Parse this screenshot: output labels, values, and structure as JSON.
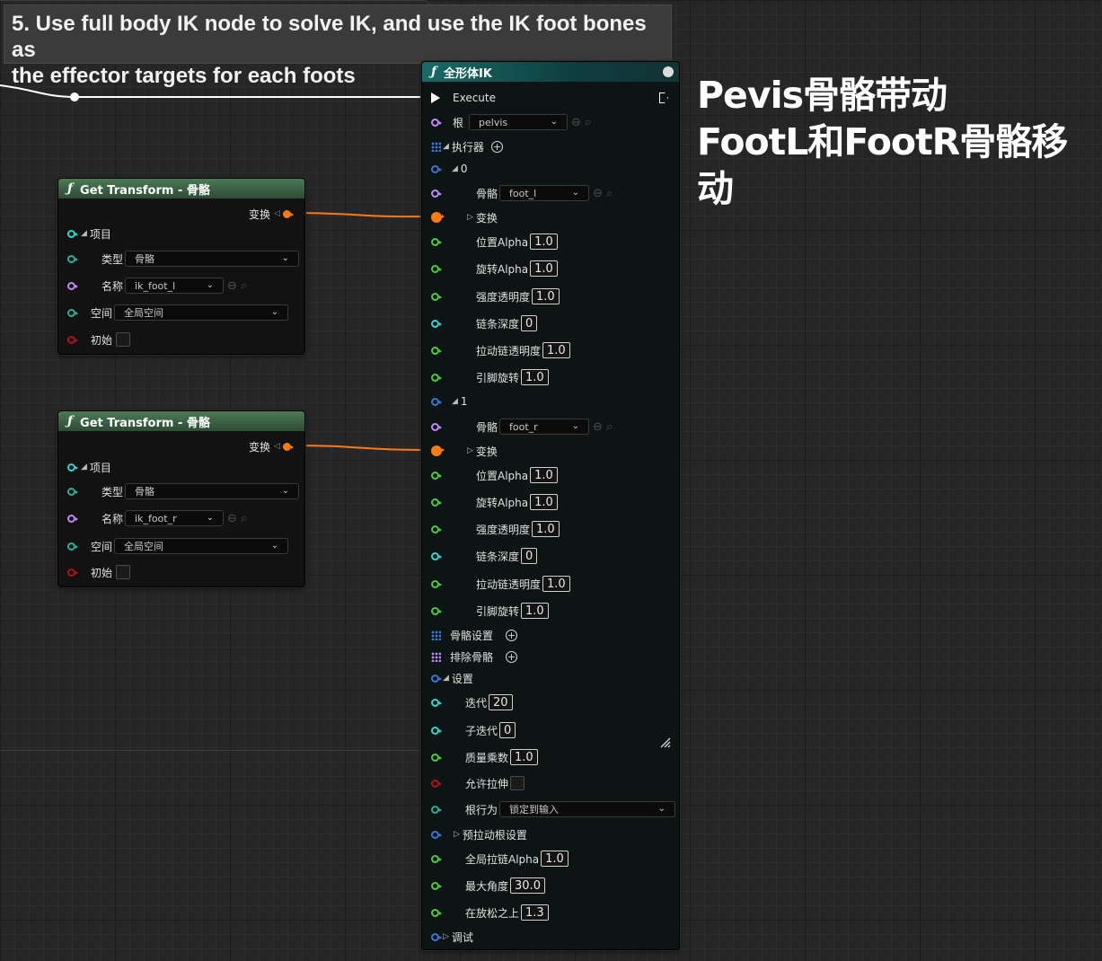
{
  "caption": {
    "line1": "5. Use full body IK node to solve IK, and use the IK foot bones as",
    "line2": "the effector targets for each foots"
  },
  "annotation": {
    "line1": "Pevis骨骼带动",
    "line2": "FootL和FootR骨骼移动"
  },
  "get_transform_1": {
    "title": "Get Transform - 骨骼",
    "output_label": "变换",
    "item_label": "项目",
    "type_label": "类型",
    "type_value": "骨骼",
    "name_label": "名称",
    "name_value": "ik_foot_l",
    "space_label": "空间",
    "space_value": "全局空间",
    "initial_label": "初始"
  },
  "get_transform_2": {
    "title": "Get Transform - 骨骼",
    "output_label": "变换",
    "item_label": "项目",
    "type_label": "类型",
    "type_value": "骨骼",
    "name_label": "名称",
    "name_value": "ik_foot_r",
    "space_label": "空间",
    "space_value": "全局空间",
    "initial_label": "初始"
  },
  "fbik": {
    "title": "全形体IK",
    "execute": "Execute",
    "root_label": "根",
    "root_value": "pelvis",
    "effectors_label": "执行器",
    "effectors": [
      {
        "index": "0",
        "bone_label": "骨骼",
        "bone_value": "foot_l",
        "transform_label": "变换",
        "pos_alpha_label": "位置Alpha",
        "pos_alpha": "1.0",
        "rot_alpha_label": "旋转Alpha",
        "rot_alpha": "1.0",
        "strength_label": "强度透明度",
        "strength": "1.0",
        "chain_depth_label": "链条深度",
        "chain_depth": "0",
        "pull_chain_label": "拉动链透明度",
        "pull_chain": "1.0",
        "pin_rot_label": "引脚旋转",
        "pin_rot": "1.0"
      },
      {
        "index": "1",
        "bone_label": "骨骼",
        "bone_value": "foot_r",
        "transform_label": "变换",
        "pos_alpha_label": "位置Alpha",
        "pos_alpha": "1.0",
        "rot_alpha_label": "旋转Alpha",
        "rot_alpha": "1.0",
        "strength_label": "强度透明度",
        "strength": "1.0",
        "chain_depth_label": "链条深度",
        "chain_depth": "0",
        "pull_chain_label": "拉动链透明度",
        "pull_chain": "1.0",
        "pin_rot_label": "引脚旋转",
        "pin_rot": "1.0"
      }
    ],
    "bone_settings_label": "骨骼设置",
    "excluded_bones_label": "排除骨骼",
    "settings_label": "设置",
    "iterations_label": "迭代",
    "iterations": "20",
    "sub_iterations_label": "子迭代",
    "sub_iterations": "0",
    "mass_mult_label": "质量乘数",
    "mass_mult": "1.0",
    "allow_stretch_label": "允许拉伸",
    "root_behavior_label": "根行为",
    "root_behavior_value": "锁定到输入",
    "pre_pull_label": "预拉动根设置",
    "global_pull_label": "全局拉链Alpha",
    "global_pull": "1.0",
    "max_angle_label": "最大角度",
    "max_angle": "30.0",
    "over_relax_label": "在放松之上",
    "over_relax": "1.3",
    "debug_label": "调试"
  },
  "colors": {
    "transform_pin": "#ff7a10",
    "float_pin": "#4ccb3f",
    "name_pin": "#c08cf2",
    "struct_pin": "#3e74d8"
  }
}
